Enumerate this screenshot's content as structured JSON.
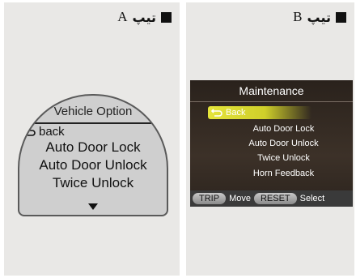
{
  "panel_a": {
    "word": "تیپ",
    "letter": "A",
    "display": {
      "title": "Vehicle Option",
      "back_label": "back",
      "options": [
        "Auto Door Lock",
        "Auto Door Unlock",
        "Twice Unlock"
      ]
    }
  },
  "panel_b": {
    "word": "تیپ",
    "letter": "B",
    "display": {
      "title": "Maintenance",
      "back_label": "Back",
      "options": [
        "Auto Door Lock",
        "Auto Door Unlock",
        "Twice Unlock",
        "Horn Feedback"
      ],
      "bottom_bar": {
        "trip": "TRIP",
        "move": "Move",
        "reset": "RESET",
        "select": "Select"
      }
    }
  },
  "icons": {
    "back": "return-arrow-icon",
    "scroll": "down-triangle-icon",
    "marker": "black-square-icon"
  },
  "colors": {
    "panel_bg": "#e9e8e6",
    "display_a_bg": "#cfcfcf",
    "display_b_bg": "#2a221c",
    "highlight": "#e5e53b"
  }
}
